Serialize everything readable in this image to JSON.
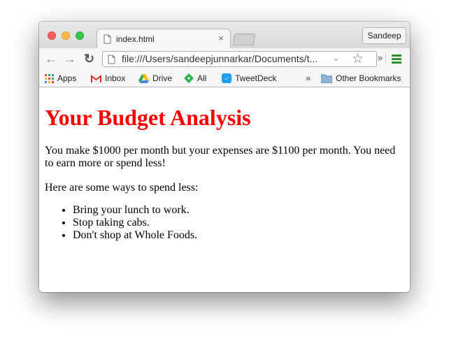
{
  "tab": {
    "title": "index.html",
    "close": "×"
  },
  "profile": {
    "name": "Sandeep"
  },
  "omnibox": {
    "url": "file:///Users/sandeepjunnarkar/Documents/t..."
  },
  "bookmarks": {
    "items": [
      {
        "label": "Apps",
        "icon": "apps-grid-icon"
      },
      {
        "label": "Inbox",
        "icon": "gmail-icon"
      },
      {
        "label": "Drive",
        "icon": "drive-icon"
      },
      {
        "label": "All",
        "icon": "feedly-icon"
      },
      {
        "label": "TweetDeck",
        "icon": "tweetdeck-icon"
      }
    ],
    "overflow": "»",
    "other": "Other Bookmarks"
  },
  "page": {
    "heading": "Your Budget Analysis",
    "summary": "You make $1000 per month but your expenses are $1100 per month. You need to earn more or spend less!",
    "tips_intro": "Here are some ways to spend less:",
    "tips": [
      "Bring your lunch to work.",
      "Stop taking cabs.",
      "Don't shop at Whole Foods."
    ]
  },
  "colors": {
    "heading": "#ff0000",
    "menu_icon": "#2f8f2f"
  }
}
